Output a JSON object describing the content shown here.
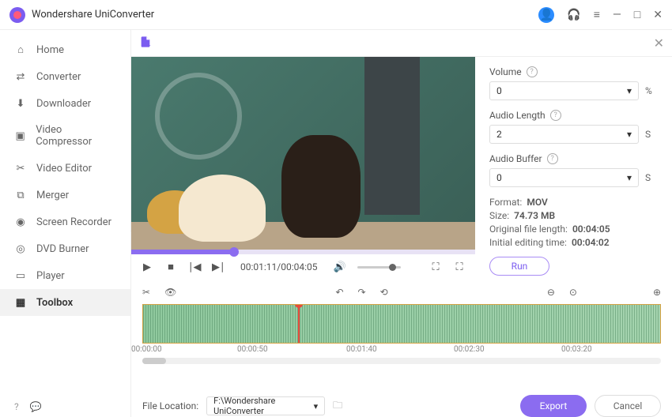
{
  "app": {
    "title": "Wondershare UniConverter"
  },
  "sidebar": {
    "items": [
      {
        "label": "Home"
      },
      {
        "label": "Converter"
      },
      {
        "label": "Downloader"
      },
      {
        "label": "Video Compressor"
      },
      {
        "label": "Video Editor"
      },
      {
        "label": "Merger"
      },
      {
        "label": "Screen Recorder"
      },
      {
        "label": "DVD Burner"
      },
      {
        "label": "Player"
      },
      {
        "label": "Toolbox"
      }
    ]
  },
  "player": {
    "current_time": "00:01:11",
    "total_time": "00:04:05",
    "time_display": "00:01:11/00:04:05"
  },
  "props": {
    "volume": {
      "label": "Volume",
      "value": "0",
      "unit": "%"
    },
    "audio_length": {
      "label": "Audio Length",
      "value": "2",
      "unit": "S"
    },
    "audio_buffer": {
      "label": "Audio Buffer",
      "value": "0",
      "unit": "S"
    },
    "format": {
      "label": "Format:",
      "value": "MOV"
    },
    "size": {
      "label": "Size:",
      "value": "74.73 MB"
    },
    "orig_length": {
      "label": "Original file length:",
      "value": "00:04:05"
    },
    "init_edit": {
      "label": "Initial editing time:",
      "value": "00:04:02"
    },
    "run": "Run"
  },
  "ruler": {
    "t0": "00:00:00",
    "t1": "00:00:50",
    "t2": "00:01:40",
    "t3": "00:02:30",
    "t4": "00:03:20"
  },
  "footer": {
    "loc_label": "File Location:",
    "loc_value": "F:\\Wondershare UniConverter",
    "export": "Export",
    "cancel": "Cancel"
  }
}
